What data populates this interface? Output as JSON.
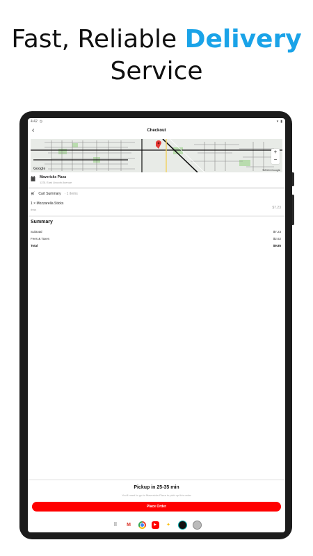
{
  "headline": {
    "line1_prefix": "Fast, Reliable ",
    "line1_accent": "Delivery",
    "line2": "Service"
  },
  "status": {
    "time": "4:42",
    "icons": [
      "clock-icon",
      "battery-icon"
    ]
  },
  "appbar": {
    "title": "Checkout",
    "back_icon": "back-arrow-icon"
  },
  "map": {
    "attribution": "©2024 Google",
    "logo": "Google",
    "zoom_in": "+",
    "zoom_out": "−"
  },
  "store": {
    "name": "Mavericks Pizza",
    "address": "1231 East Lincoln Avenue"
  },
  "cart": {
    "title": "Cart Summary",
    "count": "· 1 items",
    "items": [
      {
        "line": "1 × Mozzarella Sticks",
        "note": "dsss",
        "price": "$7.23"
      }
    ]
  },
  "summary": {
    "title": "Summary",
    "rows": [
      {
        "label": "Subtotal",
        "value": "$7.23"
      },
      {
        "label": "Fees & Taxes",
        "value": "$2.62"
      },
      {
        "label": "Total",
        "value": "$9.85"
      }
    ]
  },
  "pickup": {
    "title": "Pickup in 25-35 min",
    "subtitle": "You'll need to go to Mavericks Pizza to pick up this order"
  },
  "button": {
    "place_order": "Place Order"
  },
  "colors": {
    "accent": "#1aa3e8",
    "brand_red": "#ff0000"
  },
  "dock": {
    "apps": [
      "apps-grid-icon",
      "gmail-icon",
      "chrome-icon",
      "youtube-icon",
      "photos-icon",
      "camera-icon",
      "avatar-icon"
    ]
  }
}
